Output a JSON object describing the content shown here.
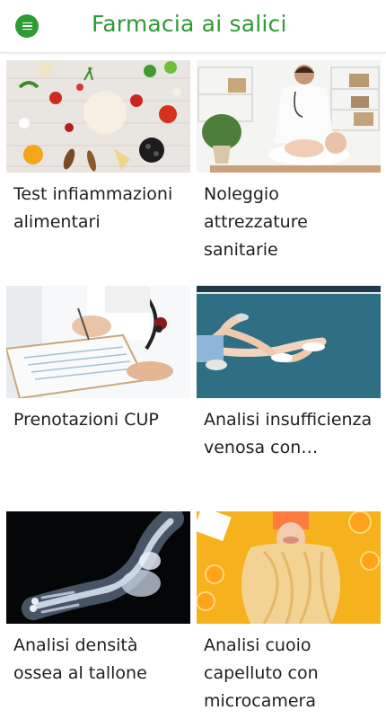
{
  "header": {
    "title": "Farmacia ai salici",
    "menu_icon": "hamburger-menu-icon",
    "accent_color": "#2e9b34"
  },
  "services": [
    {
      "label": "Test infiammazioni alimentari",
      "image": "food-ingredients-photo"
    },
    {
      "label": "Noleggio attrezzature sanitarie",
      "image": "doctor-examining-baby-photo"
    },
    {
      "label": "Prenotazioni CUP",
      "image": "doctor-filling-form-photo"
    },
    {
      "label": "Analisi insufficienza venosa con…",
      "image": "legs-on-court-photo"
    },
    {
      "label": "Analisi densità ossea al tallone",
      "image": "foot-xray-photo"
    },
    {
      "label": "Analisi cuoio capelluto con microcamera",
      "image": "woman-hair-oranges-photo"
    }
  ]
}
